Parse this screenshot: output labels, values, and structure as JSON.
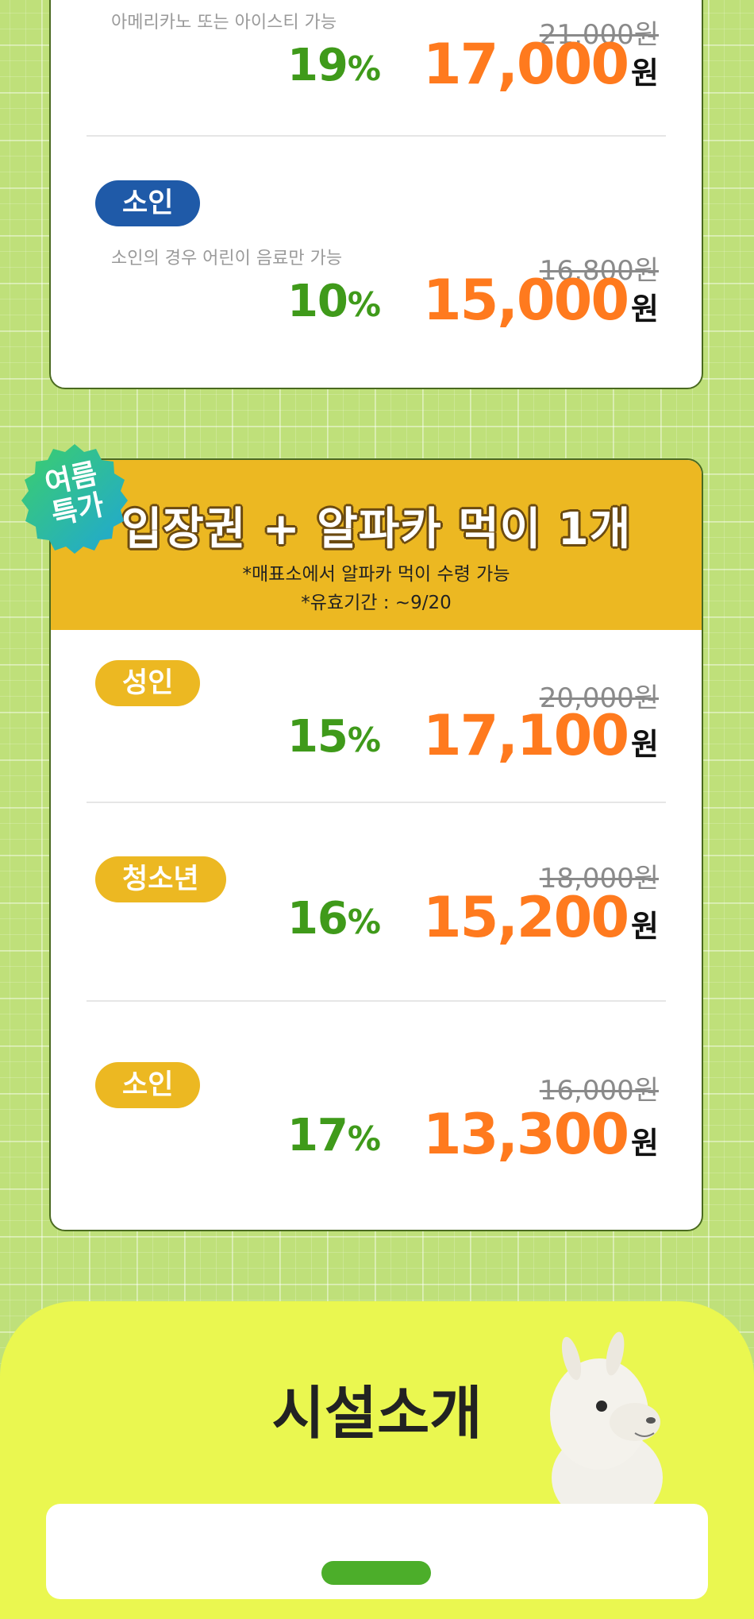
{
  "card1": {
    "rows": [
      {
        "label": "",
        "sub": "아메리카노 또는 아이스티 가능",
        "original": "21,000원",
        "discount": "19",
        "price": "17,000",
        "unit": "원"
      },
      {
        "label": "소인",
        "sub": "소인의 경우 어린이 음료만 가능",
        "original": "16,800원",
        "discount": "10",
        "price": "15,000",
        "unit": "원"
      }
    ]
  },
  "badge": {
    "line1": "여름",
    "line2": "특가"
  },
  "card2": {
    "title": "입장권 + 알파카 먹이 1개",
    "note1": "*매표소에서 알파카 먹이 수령 가능",
    "note2": "*유효기간 : ~9/20",
    "rows": [
      {
        "label": "성인",
        "original": "20,000원",
        "discount": "15",
        "price": "17,100",
        "unit": "원"
      },
      {
        "label": "청소년",
        "original": "18,000원",
        "discount": "16",
        "price": "15,200",
        "unit": "원"
      },
      {
        "label": "소인",
        "original": "16,000원",
        "discount": "17",
        "price": "13,300",
        "unit": "원"
      }
    ]
  },
  "percent_sign": "%",
  "facility": {
    "title": "시설소개"
  },
  "colors": {
    "accent_orange": "#ff7a1e",
    "discount_green": "#3f9a1a",
    "label_blue": "#1f5aa8",
    "label_yellow": "#ecb822",
    "background": "#bfe07a"
  }
}
